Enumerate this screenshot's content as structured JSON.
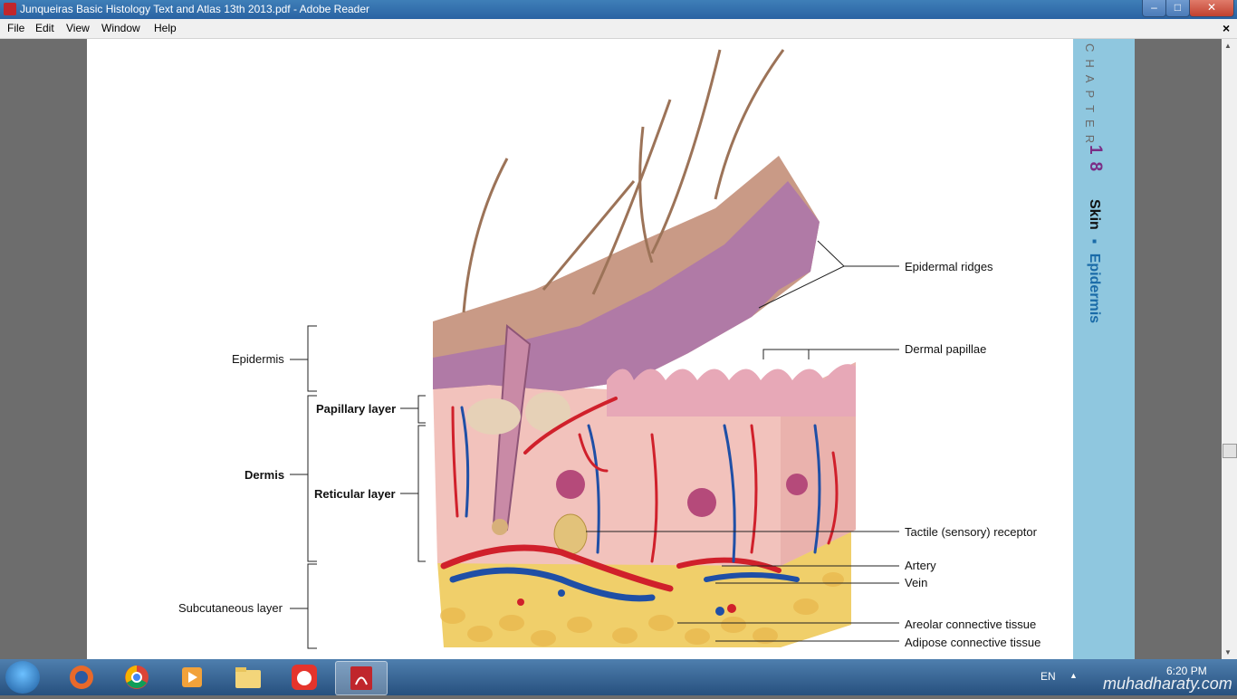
{
  "window": {
    "title": "Junqueiras Basic Histology Text and Atlas 13th 2013.pdf - Adobe Reader",
    "minimize": "–",
    "maximize": "□",
    "close": "✕"
  },
  "menu": {
    "items": [
      "File",
      "Edit",
      "View",
      "Window",
      "Help"
    ],
    "close_doc": "×"
  },
  "sidebar": {
    "chapter": "CHAPTER",
    "number": "18",
    "section": "Skin",
    "bullet": "▪",
    "subsection": "Epidermis"
  },
  "figure": {
    "labels": {
      "epidermis": "Epidermis",
      "dermis": "Dermis",
      "papillary_layer": "Papillary layer",
      "reticular_layer": "Reticular layer",
      "subcutaneous_layer": "Subcutaneous layer",
      "epidermal_ridges": "Epidermal ridges",
      "dermal_papillae": "Dermal papillae",
      "tactile_receptor": "Tactile (sensory) receptor",
      "artery": "Artery",
      "vein": "Vein",
      "areolar": "Areolar connective tissue",
      "adipose": "Adipose connective tissue"
    }
  },
  "taskbar": {
    "apps": [
      "start-button",
      "firefox-icon",
      "chrome-icon",
      "media-player-icon",
      "file-explorer-icon",
      "screen-recorder-icon",
      "adobe-reader-icon"
    ],
    "language": "EN",
    "time": "6:20 PM",
    "watermark": "muhadharaty.com"
  },
  "colors": {
    "titlebar": "#2a62a3",
    "sidebar": "#8fc7df",
    "chapter_number": "#7b2e86",
    "artery": "#d0202b",
    "vein": "#1f4fa6",
    "epidermis": "#b07aa6",
    "dermis": "#f2c2bc",
    "adipose": "#f0cf6a"
  }
}
